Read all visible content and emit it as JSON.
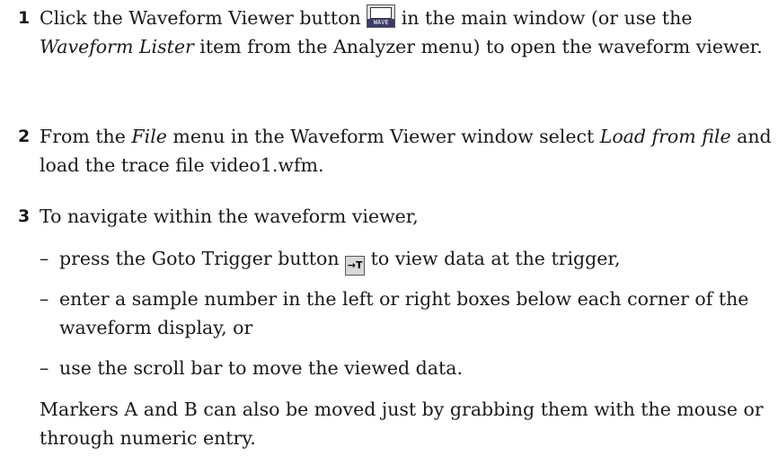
{
  "steps": [
    {
      "number": "1",
      "before_icon": "Click the Waveform Viewer button ",
      "icon": "waveform-viewer-icon",
      "icon_label": "WAVE",
      "after_icon_1": " in the main window (or use the ",
      "italic": "Waveform Lister",
      "after_italic": " item from the Analyzer menu) to open the waveform viewer."
    },
    {
      "number": "2",
      "t1": "From the ",
      "i1": "File",
      "t2": " menu in the Waveform Viewer window select ",
      "i2": "Load from file",
      "t3": " and load the trace file video1.wfm."
    },
    {
      "number": "3",
      "text": "To navigate within the waveform viewer,"
    }
  ],
  "bullets": [
    {
      "dash": "–",
      "before_icon": "press the Goto Trigger button ",
      "icon": "goto-trigger-icon",
      "icon_label": "→T",
      "after_icon": " to view data at the trigger,"
    },
    {
      "dash": "–",
      "text": "enter a sample number in the left or right boxes below each corner of the waveform display, or"
    },
    {
      "dash": "–",
      "text": "use the scroll bar to move the viewed data."
    }
  ],
  "closing": "Markers A and B can also be moved just by grabbing them with the mouse or through numeric entry."
}
